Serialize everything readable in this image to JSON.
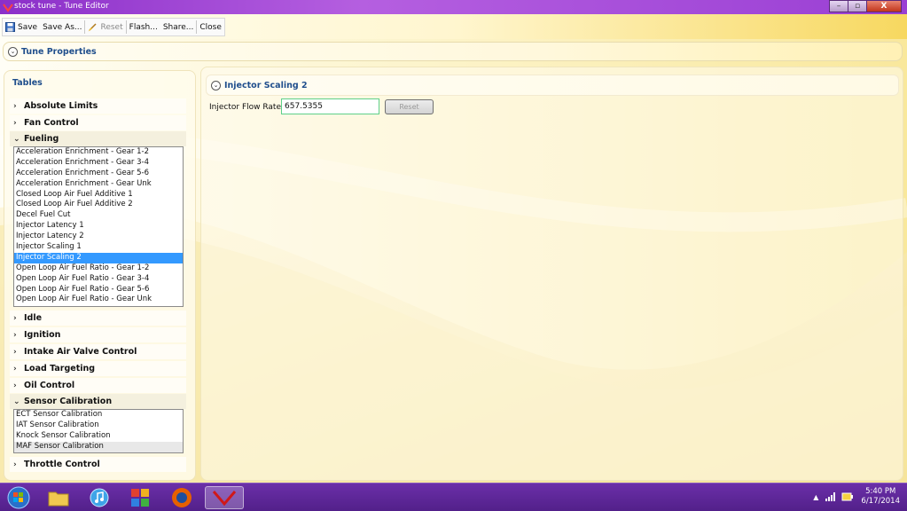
{
  "window": {
    "title": "stock tune - Tune Editor",
    "minimize": "–",
    "maximize": "▫",
    "close": "X"
  },
  "toolbar": {
    "save": "Save",
    "save_as": "Save As...",
    "reset": "Reset",
    "flash": "Flash...",
    "share": "Share...",
    "close": "Close"
  },
  "tune_properties": {
    "title": "Tune Properties"
  },
  "tables": {
    "header": "Tables",
    "groups": [
      {
        "label": "Absolute Limits",
        "expanded": false
      },
      {
        "label": "Fan Control",
        "expanded": false
      },
      {
        "label": "Fueling",
        "expanded": true
      },
      {
        "label": "Idle",
        "expanded": false
      },
      {
        "label": "Ignition",
        "expanded": false
      },
      {
        "label": "Intake Air Valve Control",
        "expanded": false
      },
      {
        "label": "Load Targeting",
        "expanded": false
      },
      {
        "label": "Oil Control",
        "expanded": false
      },
      {
        "label": "Sensor Calibration",
        "expanded": true
      },
      {
        "label": "Throttle Control",
        "expanded": false
      }
    ],
    "fueling_items": [
      "Acceleration Enrichment - Gear 1-2",
      "Acceleration Enrichment - Gear 3-4",
      "Acceleration Enrichment - Gear 5-6",
      "Acceleration Enrichment - Gear Unk",
      "Closed Loop Air Fuel Additive 1",
      "Closed Loop Air Fuel Additive 2",
      "Decel Fuel Cut",
      "Injector Latency 1",
      "Injector Latency 2",
      "Injector Scaling 1",
      "Injector Scaling 2",
      "Open Loop Air Fuel Ratio - Gear 1-2",
      "Open Loop Air Fuel Ratio - Gear 3-4",
      "Open Loop Air Fuel Ratio - Gear 5-6",
      "Open Loop Air Fuel Ratio - Gear Unk"
    ],
    "fueling_selected": "Injector Scaling 2",
    "sensor_items": [
      "ECT Sensor Calibration",
      "IAT Sensor Calibration",
      "Knock Sensor Calibration",
      "MAF Sensor Calibration"
    ]
  },
  "editor": {
    "title": "Injector Scaling 2",
    "flow_rate_label": "Injector Flow Rate:",
    "flow_rate_value": "657.5355",
    "reset_label": "Reset"
  },
  "taskbar": {
    "time": "5:40 PM",
    "date": "6/17/2014"
  },
  "colors": {
    "title_bar": "#8b2fc9",
    "taskbar": "#5a248f",
    "section_title": "#1f4e8c",
    "selection": "#3399ff"
  }
}
